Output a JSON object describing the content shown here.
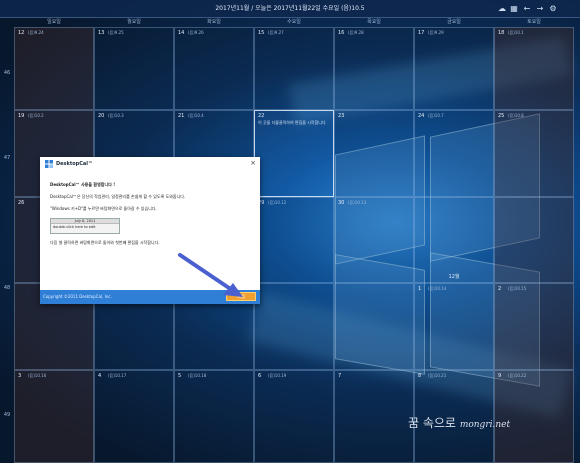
{
  "header": {
    "title": "2017년11월 / 오늘은 2017년11월22일 수요일 (음)10.5",
    "icons": [
      "cloud-icon",
      "calendar-icon",
      "arrow-left-icon",
      "arrow-right-icon",
      "gear-icon"
    ]
  },
  "weekdays": [
    "일요일",
    "월요일",
    "화요일",
    "수요일",
    "목요일",
    "금요일",
    "토요일"
  ],
  "week_numbers": [
    "46",
    "47",
    "48",
    "49"
  ],
  "weeks": [
    [
      {
        "day": "12",
        "lunar": "(음)9.24"
      },
      {
        "day": "13",
        "lunar": "(음)9.25"
      },
      {
        "day": "14",
        "lunar": "(음)9.26"
      },
      {
        "day": "15",
        "lunar": "(음)9.27"
      },
      {
        "day": "16",
        "lunar": "(음)9.28"
      },
      {
        "day": "17",
        "lunar": "(음)9.29"
      },
      {
        "day": "18",
        "lunar": "(음)10.1"
      }
    ],
    [
      {
        "day": "19",
        "lunar": "(음)10.2"
      },
      {
        "day": "20",
        "lunar": "(음)10.3"
      },
      {
        "day": "21",
        "lunar": "(음)10.4"
      },
      {
        "day": "22",
        "lunar": "",
        "text": "이 곳을 더블클릭하여 편집을 시작합니다"
      },
      {
        "day": "23",
        "lunar": ""
      },
      {
        "day": "24",
        "lunar": "(음)10.7"
      },
      {
        "day": "25",
        "lunar": "(음)10.8"
      }
    ],
    [
      {
        "day": "26",
        "lunar": ""
      },
      {
        "day": "27",
        "lunar": ""
      },
      {
        "day": "28",
        "lunar": ""
      },
      {
        "day": "29",
        "lunar": "(음)10.12"
      },
      {
        "day": "30",
        "lunar": "(음)10.13"
      },
      {
        "day": "",
        "lunar": "",
        "header": "12월"
      },
      {
        "day": "",
        "lunar": ""
      }
    ],
    [
      {
        "day": "",
        "lunar": ""
      },
      {
        "day": "",
        "lunar": ""
      },
      {
        "day": "",
        "lunar": ""
      },
      {
        "day": "",
        "lunar": ""
      },
      {
        "day": "",
        "lunar": ""
      },
      {
        "day": "1",
        "lunar": "(음)10.14"
      },
      {
        "day": "2",
        "lunar": "(음)10.15"
      }
    ],
    [
      {
        "day": "3",
        "lunar": "(음)10.16"
      },
      {
        "day": "4",
        "lunar": "(음)10.17"
      },
      {
        "day": "5",
        "lunar": "(음)10.18"
      },
      {
        "day": "6",
        "lunar": "(음)10.19"
      },
      {
        "day": "7",
        "lunar": ""
      },
      {
        "day": "8",
        "lunar": "(음)10.21"
      },
      {
        "day": "9",
        "lunar": "(음)10.22"
      }
    ]
  ],
  "dialog": {
    "title": "DesktopCal™",
    "greeting": "DesktopCal™ 사용을 환영합니다 !",
    "line1": "DesktopCal™은 당신의 작업관리, 일정관리를 손쉽게 할 수 있도록 도와줍니다.",
    "line2": "\"Windows 키+D\"를 누르면 바탕화면으로 돌아갈 수 있습니다.",
    "sample_date": "July 6, 2011",
    "sample_hint": "double-click here to edit",
    "line3": "다음 셀 클릭하면 바탕화면으로 돌아와 첫번째 편집을 시작합니다.",
    "copyright": "Copyright ©2011 DesktopCal, Inc.",
    "ok_label": "다음"
  },
  "watermark": {
    "main": "꿈 속으로",
    "sub": "mongri.net"
  }
}
